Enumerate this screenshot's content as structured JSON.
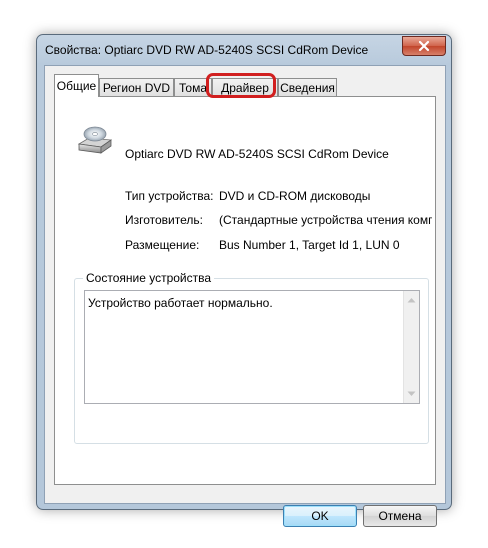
{
  "window": {
    "title": "Свойства: Optiarc DVD RW AD-5240S SCSI CdRom Device"
  },
  "tabs": [
    {
      "label": "Общие",
      "active": true
    },
    {
      "label": "Регион DVD",
      "active": false
    },
    {
      "label": "Тома",
      "active": false
    },
    {
      "label": "Драйвер",
      "active": false,
      "highlighted": true
    },
    {
      "label": "Сведения",
      "active": false
    }
  ],
  "device": {
    "icon": "cd-drive-icon",
    "name": "Optiarc DVD RW AD-5240S SCSI CdRom Device"
  },
  "properties": [
    {
      "label": "Тип устройства:",
      "value": "DVD и CD-ROM дисководы"
    },
    {
      "label": "Изготовитель:",
      "value": "(Стандартные устройства чтения компакт-д"
    },
    {
      "label": "Размещение:",
      "value": "Bus Number 1, Target Id 1, LUN 0"
    }
  ],
  "status": {
    "group_title": "Состояние устройства",
    "text": "Устройство работает нормально."
  },
  "buttons": {
    "ok": "OK",
    "cancel": "Отмена"
  },
  "colors": {
    "highlight": "#d11f1f",
    "close_button": "#c2452b",
    "frame": "#b8cadc"
  }
}
